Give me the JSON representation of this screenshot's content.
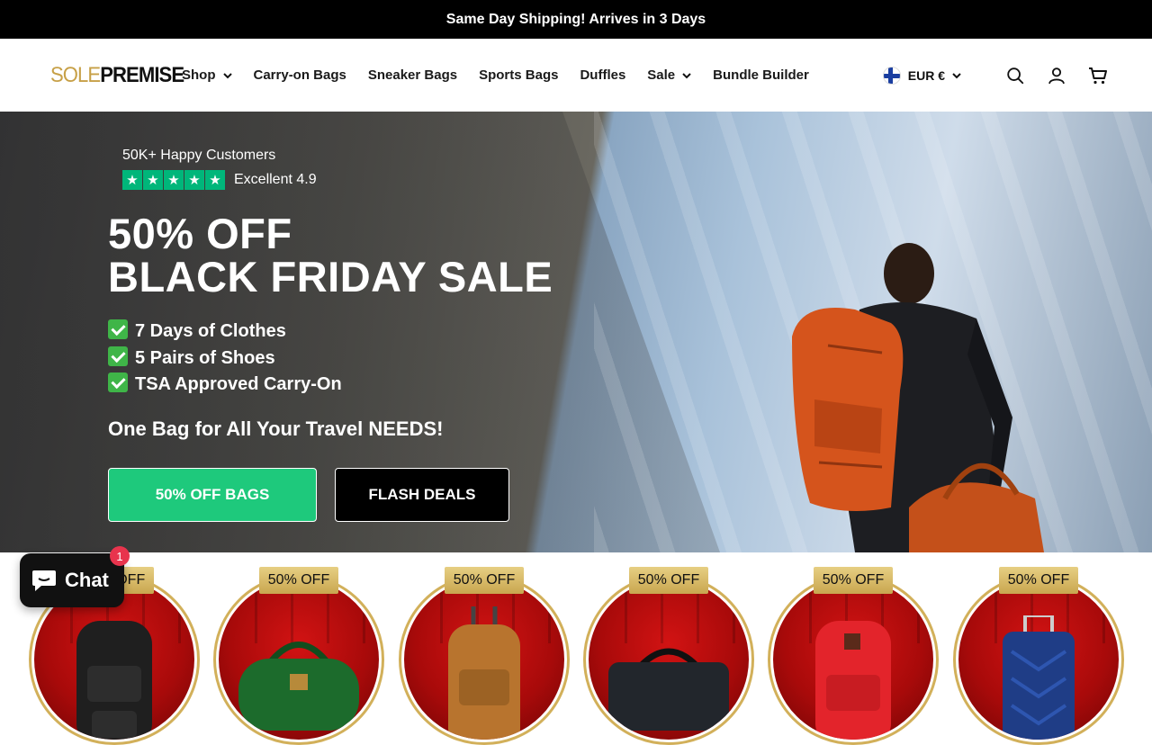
{
  "announcement": {
    "text": "Same Day Shipping! Arrives in 3 Days"
  },
  "header": {
    "logo": {
      "part1": "SOLE",
      "part2": "PREMISE"
    },
    "nav": [
      {
        "label": "Shop",
        "dropdown": true
      },
      {
        "label": "Carry-on Bags",
        "dropdown": false
      },
      {
        "label": "Sneaker Bags",
        "dropdown": false
      },
      {
        "label": "Sports Bags",
        "dropdown": false
      },
      {
        "label": "Duffles",
        "dropdown": false
      },
      {
        "label": "Sale",
        "dropdown": true
      },
      {
        "label": "Bundle Builder",
        "dropdown": false
      }
    ],
    "currency": {
      "label": "EUR €",
      "flag": "finland-flag"
    },
    "icons": [
      "search-icon",
      "account-icon",
      "cart-icon"
    ]
  },
  "hero": {
    "rating_label": "50K+ Happy Customers",
    "rating_stars": 5,
    "rating_text": "Excellent 4.9",
    "headline_line1": "50% OFF",
    "headline_line2": "BLACK FRIDAY SALE",
    "bullets": [
      "7 Days of Clothes",
      "5 Pairs of Shoes",
      "TSA Approved Carry-On"
    ],
    "tagline": "One Bag for All Your Travel NEEDS!",
    "primary_button": "50% OFF BAGS",
    "secondary_button": "FLASH DEALS"
  },
  "products": [
    {
      "badge": "50% OFF",
      "color": "#1f1f1f"
    },
    {
      "badge": "50% OFF",
      "color": "#1c6b2c"
    },
    {
      "badge": "50% OFF",
      "color": "#b8742e"
    },
    {
      "badge": "50% OFF",
      "color": "#22262c"
    },
    {
      "badge": "50% OFF",
      "color": "#e3242b"
    },
    {
      "badge": "50% OFF",
      "color": "#1f3d86"
    }
  ],
  "chat": {
    "label": "Chat",
    "count": "1"
  },
  "colors": {
    "accent_green": "#1ec97c",
    "gold": "#c7a047",
    "trustpilot": "#00b67a"
  }
}
